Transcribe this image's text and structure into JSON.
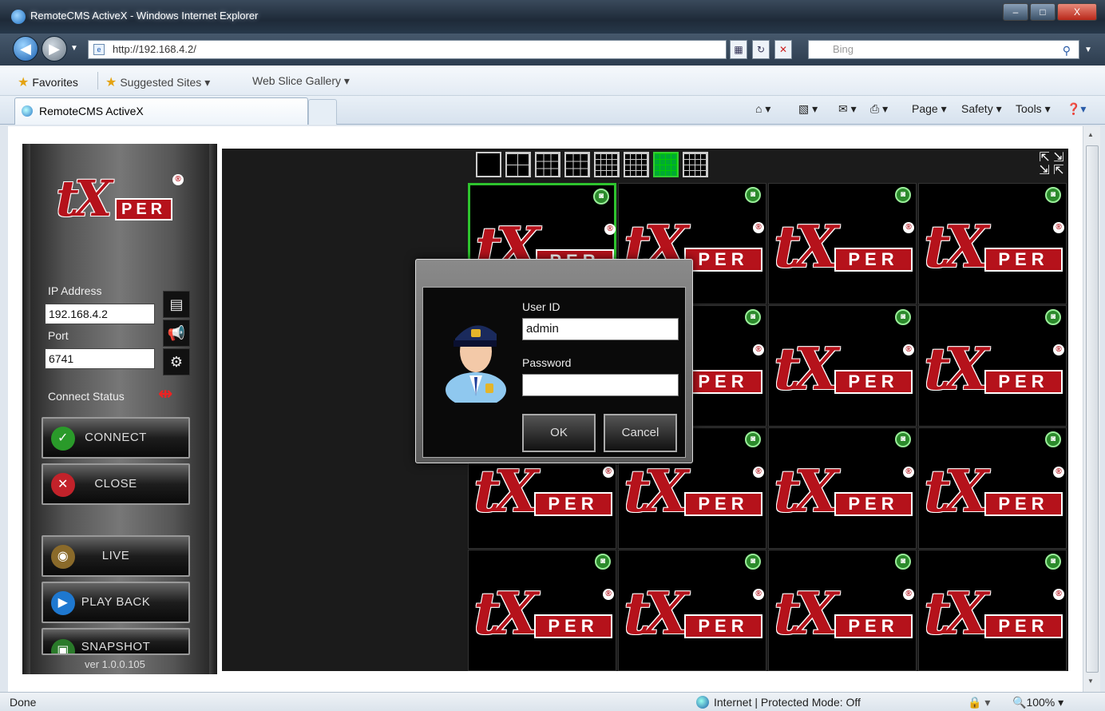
{
  "window": {
    "title": "RemoteCMS ActiveX - Windows Internet Explorer",
    "minimize": "–",
    "maximize": "□",
    "close": "X"
  },
  "nav": {
    "address": "http://192.168.4.2/",
    "search_placeholder": "Bing"
  },
  "favorites": {
    "favorites_label": "Favorites",
    "suggested_sites": "Suggested Sites ▾",
    "web_slice_gallery": "Web Slice Gallery ▾"
  },
  "tab": {
    "label": "RemoteCMS ActiveX"
  },
  "commandbar": {
    "page": "Page ▾",
    "safety": "Safety ▾",
    "tools": "Tools ▾"
  },
  "panel": {
    "ip_label": "IP Address",
    "ip_value": "192.168.4.2",
    "port_label": "Port",
    "port_value": "6741",
    "connect_status_label": "Connect Status",
    "connect": "CONNECT",
    "close": "CLOSE",
    "live": "LIVE",
    "playback": "PLAY BACK",
    "snapshot": "SNAPSHOT",
    "version": "ver 1.0.0.105"
  },
  "logo": {
    "tx": "tX",
    "per": "PER",
    "reg": "®"
  },
  "viewer": {
    "selected_layout_index": 6
  },
  "dialog": {
    "user_id_label": "User ID",
    "user_id_value": "admin",
    "password_label": "Password",
    "password_value": "",
    "ok": "OK",
    "cancel": "Cancel"
  },
  "statusbar": {
    "left": "Done",
    "zone": "Internet | Protected Mode: Off",
    "zoom": "100%"
  },
  "colors": {
    "brand_red": "#b5121b",
    "selection_green": "#2ec42e"
  }
}
